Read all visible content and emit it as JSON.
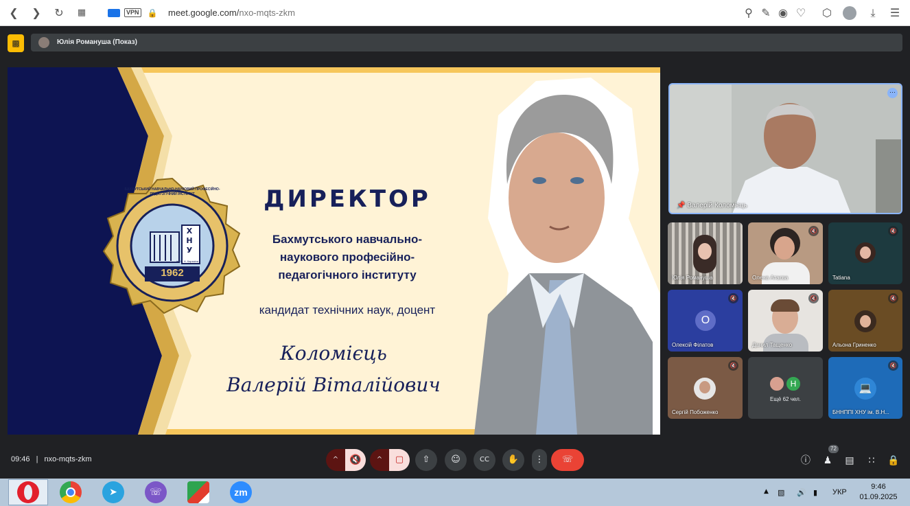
{
  "browser": {
    "url_host": "meet.google.com/",
    "url_path": "nxo-mqts-zkm",
    "vpn_label": "VPN"
  },
  "presenter_bar": {
    "name": "Юлія Романуша (Показ)"
  },
  "slide": {
    "title": "ДИРЕКТОР",
    "institution_lines": [
      "Бахмутського навчально-",
      "наукового професійно-",
      "педагогічного інституту"
    ],
    "degree": "кандидат технічних наук, доцент",
    "surname": "Коломієць",
    "given_names": "Валерій Віталійович",
    "seal_arc_text": "БАХМУТСЬКИЙ НАВЧАЛЬНО-НАУКОВИЙ ПРОФЕСІЙНО-ПЕДАГОГІЧНИЙ ІНСТИТУТ",
    "seal_letters": "ХНУ",
    "seal_sub": "ім. В. Н. Каразіна",
    "seal_year": "1962"
  },
  "participants": {
    "featured": {
      "name": "Валерій Коломієць"
    },
    "tiles": [
      {
        "name": "Юлія Романуша"
      },
      {
        "name": "Олена Атаєва"
      },
      {
        "name": "Tatiana"
      },
      {
        "name": "Олексій Філатов",
        "initial": "О"
      },
      {
        "name": "Данил Тащенко"
      },
      {
        "name": "Альона Гриненко"
      },
      {
        "name": "Сергій Побоженко"
      },
      {
        "name": "Ещё 62 чел.",
        "initial": "Н"
      },
      {
        "name": "БННППІ ХНУ ім. В.Н..."
      }
    ]
  },
  "controls": {
    "time": "09:46",
    "separator": "|",
    "meeting_code": "nxo-mqts-zkm",
    "people_count": "72"
  },
  "taskbar": {
    "language": "УКР",
    "clock_time": "9:46",
    "clock_date": "01.09.2025",
    "zoom_label": "zm"
  },
  "colors": {
    "meet_bg": "#202124",
    "slide_navy": "#0d1452",
    "slide_gold": "#d4a846",
    "slide_cream": "#fff3d6",
    "end_call_red": "#ea4335",
    "presenting_yellow": "#fbbc04"
  }
}
